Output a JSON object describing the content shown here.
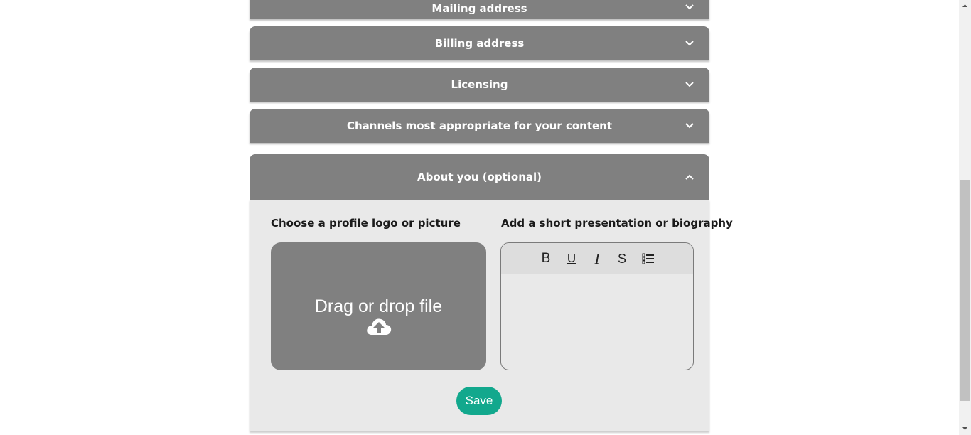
{
  "accordion": {
    "mailing_label": "Mailing address",
    "billing_label": "Billing address",
    "licensing_label": "Licensing",
    "channels_label": "Channels most appropriate for your content",
    "about_label": "About you (optional)"
  },
  "about": {
    "logo_title": "Choose a profile logo or picture",
    "bio_title": "Add a short presentation or biography",
    "dropzone_text": "Drag or drop file",
    "toolbar": {
      "bold": "B",
      "underline": "U",
      "italic": "I",
      "strike": "S"
    },
    "save_label": "Save"
  },
  "colors": {
    "accordion_bg": "#808080",
    "panel_bg": "#e9e9e9",
    "save_button": "#12a88d"
  },
  "icons": {
    "accordion_closed": "chevron-down-icon",
    "accordion_open": "chevron-up-icon",
    "upload": "cloud-upload-icon",
    "list": "ordered-list-icon"
  }
}
